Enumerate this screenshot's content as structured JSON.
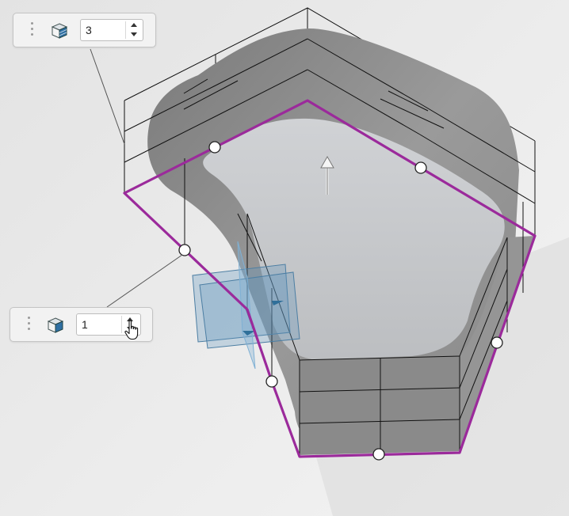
{
  "tools": {
    "top_panel": {
      "icon": "stacked-block-icon",
      "value": "3"
    },
    "bottom_panel": {
      "icon": "block-icon",
      "value": "1"
    }
  },
  "viewport": {
    "accent_outline": "#9b2a9b",
    "wall_fill": "#8c8c8c",
    "top_face_fill": "#c5c7ca",
    "plane_fill": "#5f95bd"
  },
  "icons": [
    "drag-grip-icon",
    "stacked-block-icon",
    "block-icon",
    "spin-up-icon",
    "spin-down-icon",
    "hand-pointer-icon",
    "direction-arrow-icon"
  ]
}
